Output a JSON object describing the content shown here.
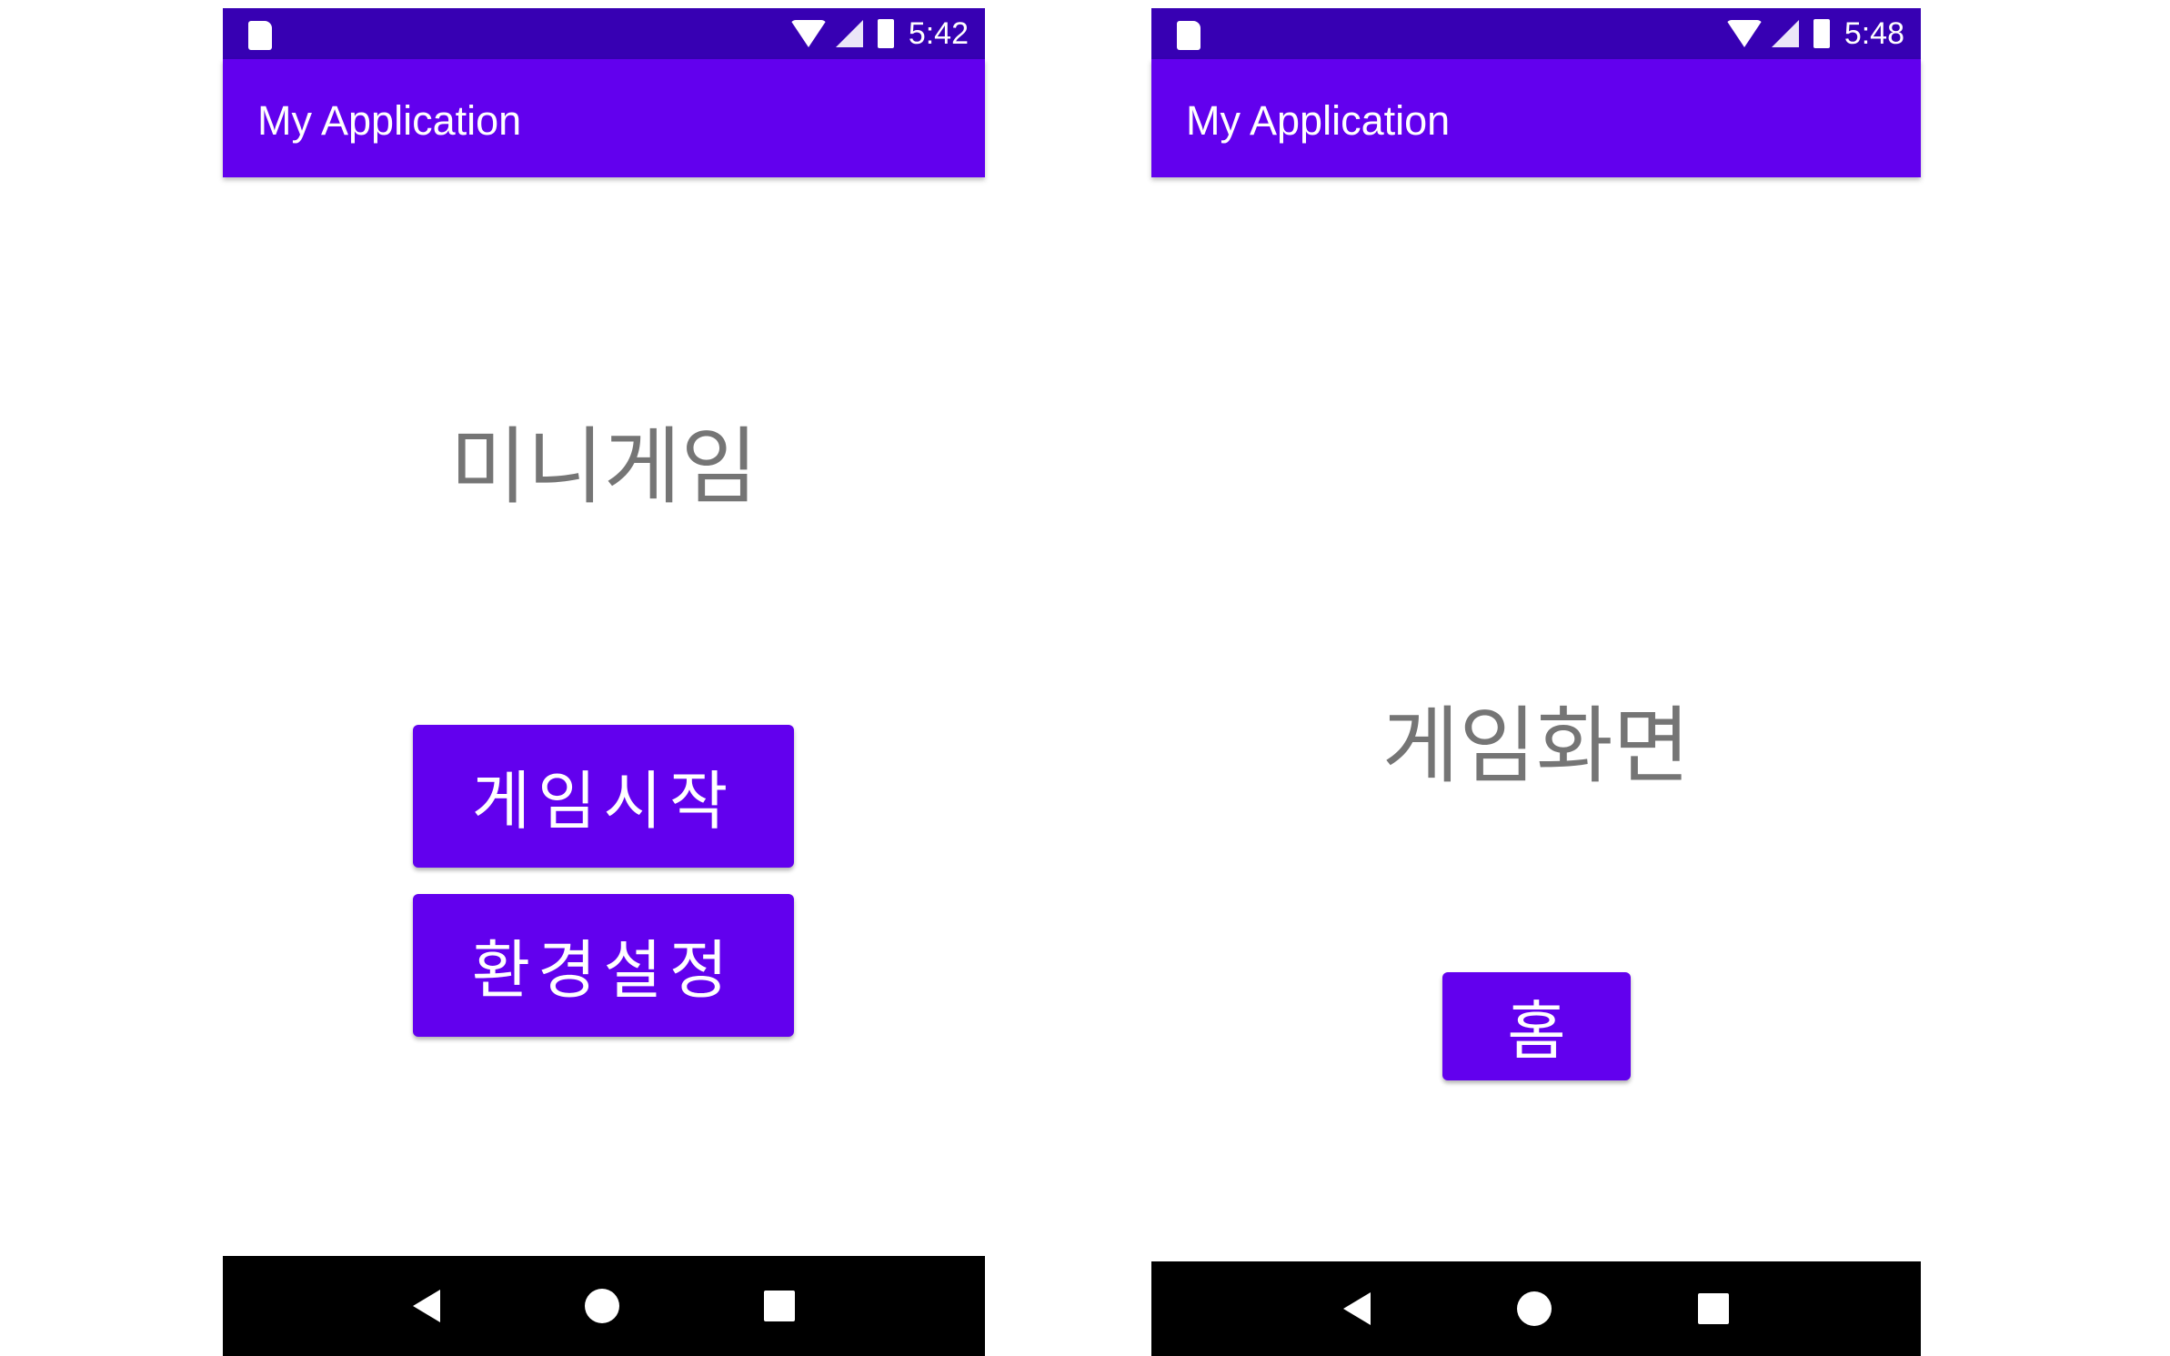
{
  "screens": [
    {
      "status_time": "5:42",
      "app_title": "My Application",
      "heading": "미니게임",
      "buttons": [
        "게임시작",
        "환경설정"
      ]
    },
    {
      "status_time": "5:48",
      "app_title": "My Application",
      "heading": "게임화면",
      "buttons": [
        "홈"
      ]
    }
  ],
  "colors": {
    "status_bar": "#3700B3",
    "app_bar": "#6200EE",
    "button": "#6200EE",
    "heading": "#757575"
  }
}
